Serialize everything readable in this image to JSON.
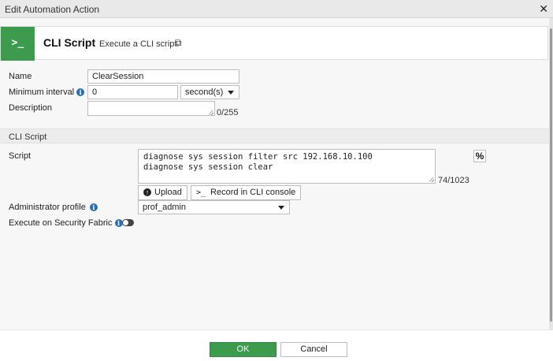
{
  "window": {
    "title": "Edit Automation Action",
    "close_icon": "close-icon"
  },
  "header": {
    "badge_glyph": ">_",
    "name": "CLI Script",
    "description": "Execute a CLI script.",
    "external_link_icon": "external-link-icon",
    "badge_color": "#3d9b4e"
  },
  "form": {
    "name_label": "Name",
    "name_value": "ClearSession",
    "min_interval_label": "Minimum interval",
    "min_interval_value": "0",
    "interval_unit": "second(s)",
    "description_label": "Description",
    "description_value": "",
    "description_counter": "0/255"
  },
  "cli_section": {
    "title": "CLI Script",
    "script_label": "Script",
    "script_text": "diagnose sys session filter src 192.168.10.100\ndiagnose sys session clear",
    "script_counter": "74/1023",
    "percent_button": "%",
    "upload_label": "Upload",
    "record_label": "Record in CLI console",
    "record_glyph": ">_",
    "admin_profile_label": "Administrator profile",
    "admin_profile_value": "prof_admin",
    "security_fabric_label": "Execute on Security Fabric",
    "security_fabric_enabled": false
  },
  "footer": {
    "ok_label": "OK",
    "cancel_label": "Cancel",
    "ok_color": "#3d9b4e"
  }
}
